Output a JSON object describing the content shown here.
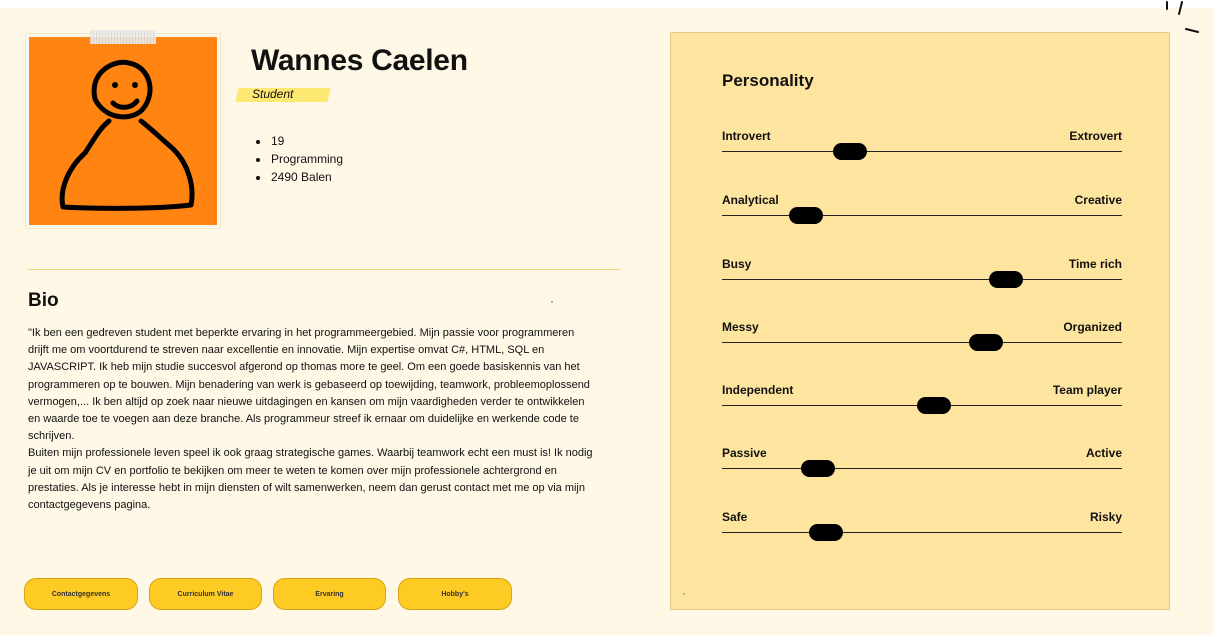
{
  "profile": {
    "name": "Wannes Caelen",
    "role": "Student",
    "facts": [
      "19",
      "Programming",
      "2490 Balen"
    ],
    "avatar_icon": "smiley-person-drawing-icon"
  },
  "bio": {
    "title": "Bio",
    "text": "\"Ik ben een gedreven student met beperkte  ervaring in het programmeergebied. Mijn passie voor programmeren drijft me om voortdurend te streven naar excellentie en innovatie. Mijn expertise omvat C#, HTML, SQL en JAVASCRIPT.  Ik heb mijn studie succesvol afgerond op thomas more te geel. Om een goede basiskennis van het programmeren op te bouwen. Mijn benadering van werk is gebaseerd op toewijding, teamwork, probleemoplossend vermogen,... Ik ben altijd op zoek naar nieuwe uitdagingen en kansen om mijn vaardigheden verder te ontwikkelen en waarde toe te voegen aan deze branche. Als programmeur streef ik ernaar om duidelijke en werkende code te schrijven.\nBuiten mijn professionele leven speel ik ook graag strategische games. Waarbij teamwork echt een must is! Ik nodig je uit om mijn CV en portfolio te bekijken om meer te weten te komen over mijn professionele achtergrond en prestaties. Als je interesse hebt in mijn diensten of wilt samenwerken, neem dan gerust contact met me op via mijn contactgegevens pagina."
  },
  "nav": {
    "contact_label": "Contactgegevens",
    "cv_label": "Curriculum Vitae",
    "experience_label": "Ervaring",
    "hobbies_label": "Hobby's"
  },
  "personality": {
    "title": "Personality",
    "traits": [
      {
        "left": "Introvert",
        "right": "Extrovert",
        "value": 0.32
      },
      {
        "left": "Analytical",
        "right": "Creative",
        "value": 0.21
      },
      {
        "left": "Busy",
        "right": "Time rich",
        "value": 0.71
      },
      {
        "left": "Messy",
        "right": "Organized",
        "value": 0.66
      },
      {
        "left": "Independent",
        "right": "Team player",
        "value": 0.53
      },
      {
        "left": "Passive",
        "right": "Active",
        "value": 0.24
      },
      {
        "left": "Safe",
        "right": "Risky",
        "value": 0.26
      }
    ]
  },
  "colors": {
    "background": "#fff8e6",
    "avatar_bg": "#ff8412",
    "panel_bg": "#fee59f",
    "button_bg": "#fecb24",
    "role_highlight": "#fde871"
  }
}
